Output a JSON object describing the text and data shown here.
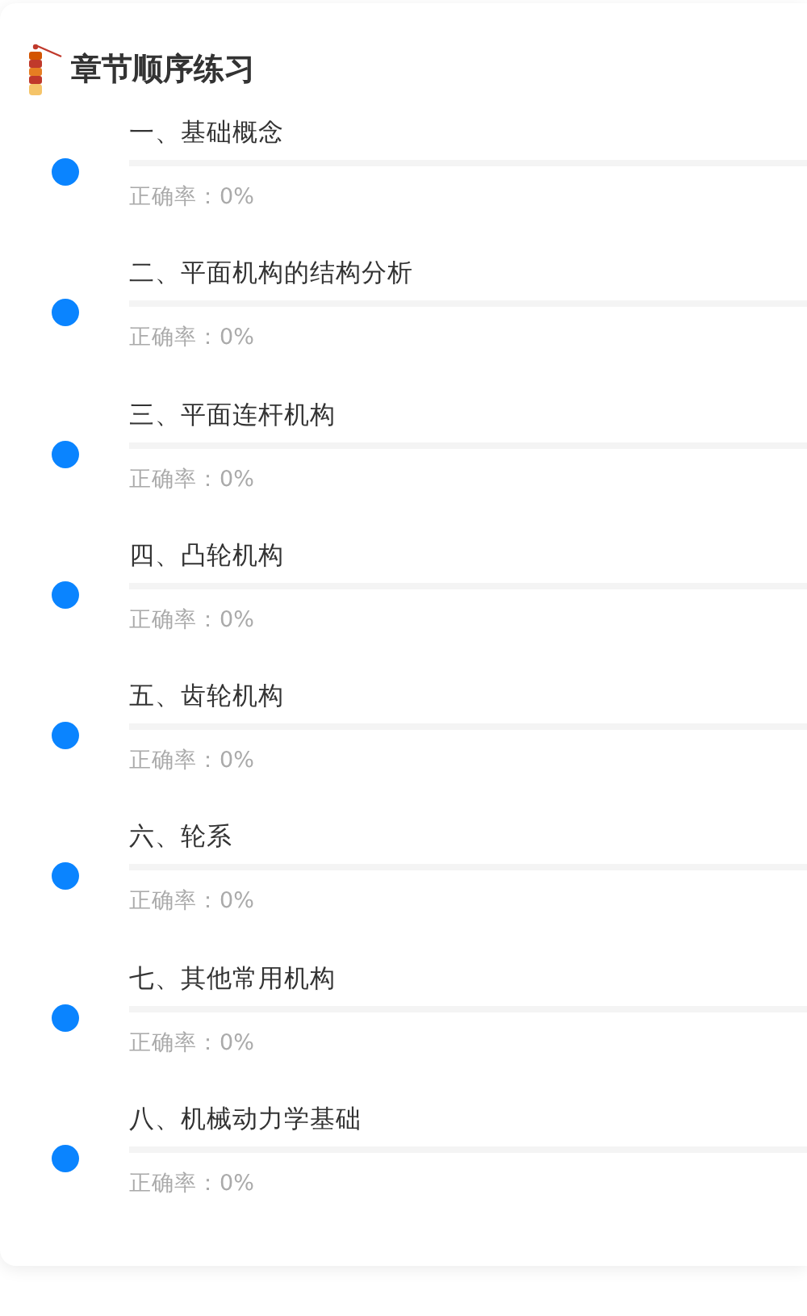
{
  "header": {
    "title": "章节顺序练习"
  },
  "chapters": [
    {
      "name": "一、基础概念",
      "accuracy": "正确率：0%",
      "level": 0
    },
    {
      "name": "二、平面机构的结构分析",
      "accuracy": "正确率：0%",
      "level": 0
    },
    {
      "name": "三、平面连杆机构",
      "accuracy": "正确率：0%",
      "level": 0
    },
    {
      "name": "四、凸轮机构",
      "accuracy": "正确率：0%",
      "level": 0
    },
    {
      "name": "五、齿轮机构",
      "accuracy": "正确率：0%",
      "level": 0
    },
    {
      "name": "六、轮系",
      "accuracy": "正确率：0%",
      "level": 0
    },
    {
      "name": "七、其他常用机构",
      "accuracy": "正确率：0%",
      "level": 0
    },
    {
      "name": "八、机械动力学基础",
      "accuracy": "正确率：0%",
      "level": 0
    }
  ]
}
